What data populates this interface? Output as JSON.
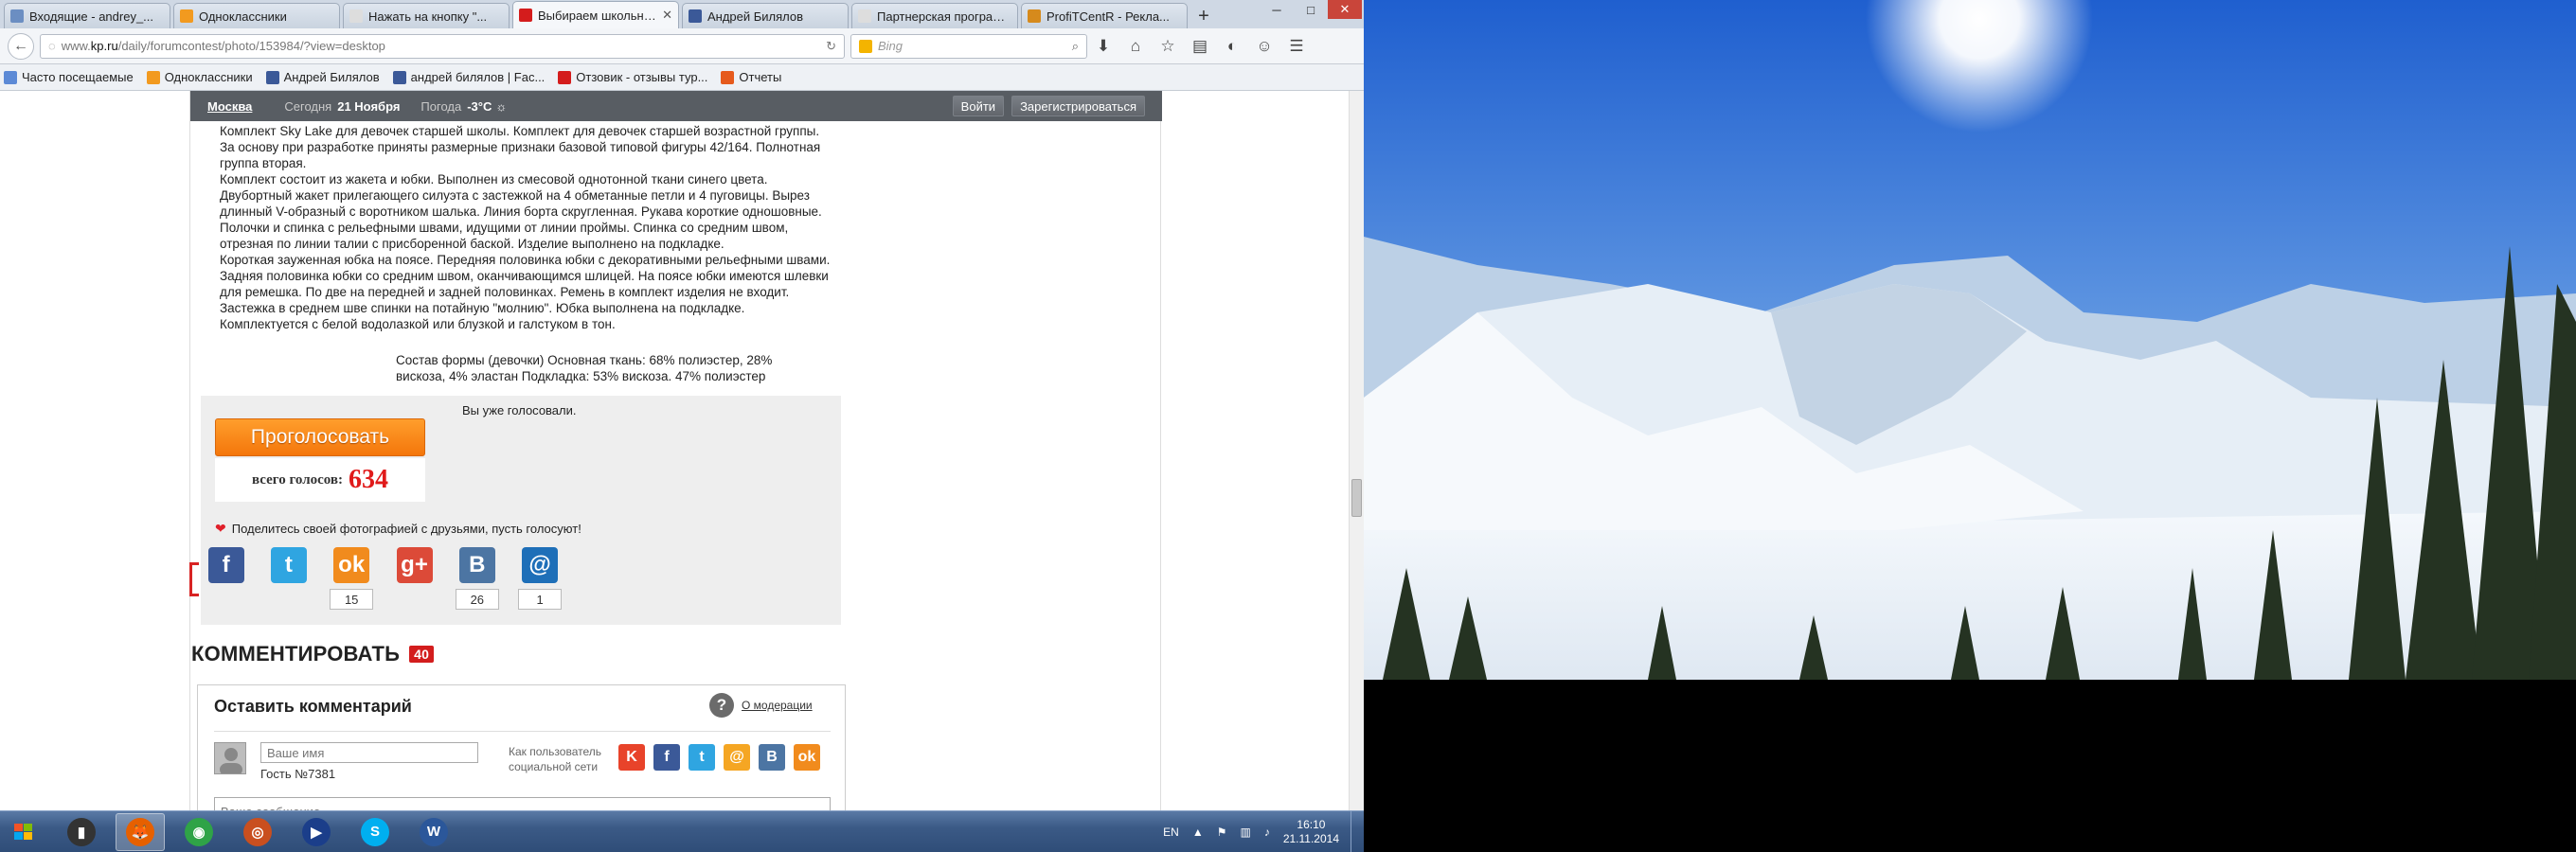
{
  "browser": {
    "tabs": [
      {
        "title": "Входящие - andrey_...",
        "favicon_color": "#6b8ec2"
      },
      {
        "title": "Одноклассники",
        "favicon_color": "#f29a1f"
      },
      {
        "title": "Нажать на кнопку \"...",
        "favicon_color": "#dddddd"
      },
      {
        "title": "Выбираем школьну...",
        "favicon_color": "#d41c1c",
        "active": true
      },
      {
        "title": "Андрей Билялов",
        "favicon_color": "#3b5998"
      },
      {
        "title": "Партнерская программ...",
        "favicon_color": "#dddddd"
      },
      {
        "title": "ProfiTCentR - Рекла...",
        "favicon_color": "#d68a1c"
      }
    ],
    "new_tab": "+",
    "window_controls": {
      "minimize": "─",
      "maximize": "□",
      "close": "✕"
    },
    "address": {
      "prefix": "www.",
      "domain": "kp.ru",
      "path": "/daily/forumcontest/photo/153984/?view=desktop"
    },
    "search": {
      "placeholder": "Bing"
    },
    "bookmarks": [
      {
        "label": "Часто посещаемые",
        "color": "#5c8ad6"
      },
      {
        "label": "Одноклассники",
        "color": "#f29a1f"
      },
      {
        "label": "Андрей Билялов",
        "color": "#3b5998"
      },
      {
        "label": "андрей билялов | Fac...",
        "color": "#3b5998"
      },
      {
        "label": "Отзовик - отзывы тур...",
        "color": "#d41c1c"
      },
      {
        "label": "Отчеты",
        "color": "#e65a1c"
      }
    ]
  },
  "page": {
    "topbar": {
      "city": "Москва",
      "today_label": "Сегодня",
      "today_date": "21 Ноября",
      "weather_label": "Погода",
      "weather_value": "-3°C",
      "login": "Войти",
      "register": "Зарегистрироваться"
    },
    "description": [
      "Комплект Sky Lake для девочек старшей школы. Комплект для девочек старшей возрастной группы. За основу при разработке приняты размерные признаки базовой типовой фигуры 42/164. Полнотная группа вторая.",
      "Комплект состоит из жакета и юбки. Выполнен из смесовой однотонной ткани синего цвета. Двубортный жакет прилегающего силуэта с застежкой на 4 обметанные петли и 4 пуговицы. Вырез длинный V-образный с воротником шалька. Линия борта скругленная. Рукава короткие одношовные. Полочки и спинка с рельефными швами, идущими от линии проймы. Спинка со средним швом, отрезная по линии талии с присборенной баской. Изделие выполнено на подкладке.",
      "Короткая зауженная юбка на поясе. Передняя половинка юбки с декоративными рельефными швами. Задняя половинка юбки со средним швом, оканчивающимся шлицей. На поясе юбки имеются шлевки для ремешка. По две на передней и задней половинках. Ремень в комплект изделия не входит. Застежка в среднем шве спинки на потайную \"молнию\". Юбка выполнена на подкладке. Комплектуется с белой водолазкой или блузкой и галстуком в тон."
    ],
    "composition": "Состав формы (девочки)    Основная ткань: 68% полиэстер, 28% вискоза, 4% эластан Подкладка: 53% вискоза. 47% полиэстер",
    "vote": {
      "already_voted": "Вы уже голосовали.",
      "button": "Проголосовать",
      "total_label": "всего голосов:",
      "total_value": "634"
    },
    "share": {
      "text": "Поделитесь своей фотографией с друзьями, пусть голосуют!",
      "buttons": [
        {
          "name": "facebook",
          "glyph": "f",
          "color": "#3b5998",
          "count": ""
        },
        {
          "name": "twitter",
          "glyph": "t",
          "color": "#2fa5e1",
          "count": ""
        },
        {
          "name": "odnoklassniki",
          "glyph": "ok",
          "color": "#f18b1d",
          "count": "15"
        },
        {
          "name": "googleplus",
          "glyph": "g+",
          "color": "#dc4a38",
          "count": ""
        },
        {
          "name": "vkontakte",
          "glyph": "B",
          "color": "#4c75a3",
          "count": "26"
        },
        {
          "name": "mailru",
          "glyph": "@",
          "color": "#1e6fb8",
          "count": "1"
        }
      ]
    },
    "comments": {
      "heading": "КОММЕНТИРОВАТЬ",
      "count": "40",
      "box_title": "Оставить комментарий",
      "moderation": "О модерации",
      "name_placeholder": "Ваше имя",
      "guest": "Гость №7381",
      "as_user_line1": "Как пользователь",
      "as_user_line2": "социальной сети",
      "message_placeholder": "Ваше сообщение",
      "networks": [
        {
          "name": "kp",
          "glyph": "K",
          "color": "#e8432a"
        },
        {
          "name": "facebook",
          "glyph": "f",
          "color": "#3b5998"
        },
        {
          "name": "twitter",
          "glyph": "t",
          "color": "#2fa5e1"
        },
        {
          "name": "mailru",
          "glyph": "@",
          "color": "#f5a623"
        },
        {
          "name": "vkontakte",
          "glyph": "B",
          "color": "#4c75a3"
        },
        {
          "name": "odnoklassniki",
          "glyph": "ok",
          "color": "#f18b1d"
        }
      ]
    }
  },
  "taskbar": {
    "apps": [
      {
        "name": "explorer",
        "glyph": "▮",
        "color": "#333333"
      },
      {
        "name": "firefox",
        "glyph": "🦊",
        "color": "#e66000",
        "active": true
      },
      {
        "name": "chrome",
        "glyph": "◉",
        "color": "#2fa347"
      },
      {
        "name": "viewer",
        "glyph": "◎",
        "color": "#c94f1f"
      },
      {
        "name": "media",
        "glyph": "▶",
        "color": "#1b3e8a"
      },
      {
        "name": "skype",
        "glyph": "S",
        "color": "#00aff0"
      },
      {
        "name": "word",
        "glyph": "W",
        "color": "#2b579a"
      }
    ],
    "lang": "EN",
    "time": "16:10",
    "date": "21.11.2014"
  }
}
